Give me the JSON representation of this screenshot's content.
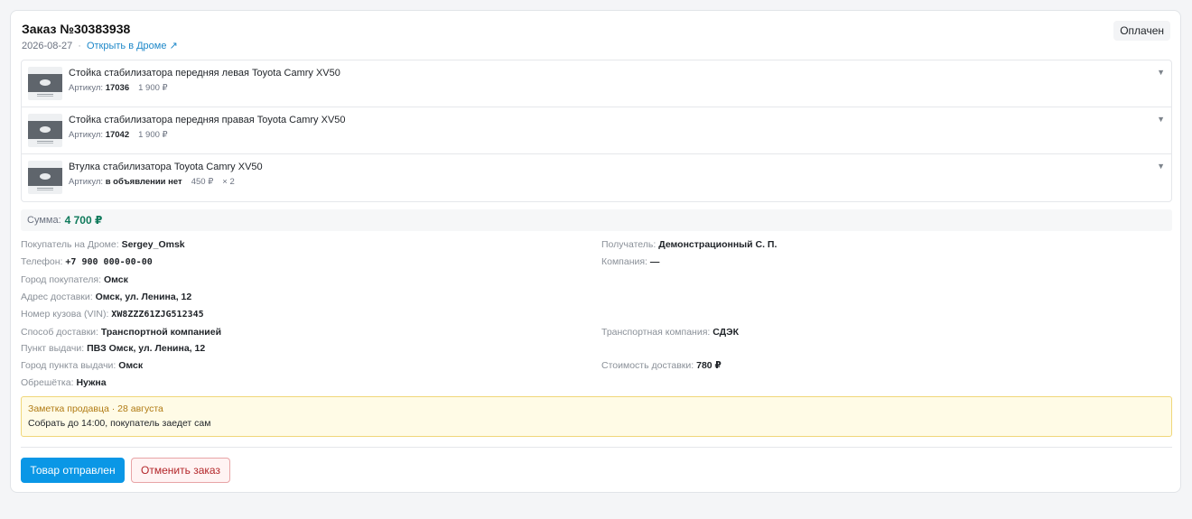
{
  "order": {
    "title": "Заказ №30383938",
    "date": "2026-08-27",
    "separator": "·",
    "open_link": "Открыть в Дроме ↗",
    "status": "Оплачен"
  },
  "items": [
    {
      "name": "Стойка стабилизатора передняя левая Toyota Camry XV50",
      "sku_label": "Артикул:",
      "sku": "17036",
      "price": "1 900 ₽",
      "qty": ""
    },
    {
      "name": "Стойка стабилизатора передняя правая Toyota Camry XV50",
      "sku_label": "Артикул:",
      "sku": "17042",
      "price": "1 900 ₽",
      "qty": ""
    },
    {
      "name": "Втулка стабилизатора Toyota Camry XV50",
      "sku_label": "Артикул:",
      "sku": "в объявлении нет",
      "price": "450 ₽",
      "qty": "× 2"
    }
  ],
  "chevron": "▼",
  "sum": {
    "label": "Сумма:",
    "value": "4 700 ₽"
  },
  "fields": {
    "buyer": {
      "label": "Покупатель на Дроме:",
      "value": "Sergey_Omsk"
    },
    "phone": {
      "label": "Телефон:",
      "value": "+7 900 000-00-00"
    },
    "city": {
      "label": "Город покупателя:",
      "value": "Омск"
    },
    "address": {
      "label": "Адрес доставки:",
      "value": "Омск, ул. Ленина, 12"
    },
    "vin": {
      "label": "Номер кузова (VIN):",
      "value": "XW8ZZZ61ZJG512345"
    },
    "delivery_method": {
      "label": "Способ доставки:",
      "value": "Транспортной компанией"
    },
    "pickup_point": {
      "label": "Пункт выдачи:",
      "value": "ПВЗ Омск, ул. Ленина, 12"
    },
    "pickup_city": {
      "label": "Город пункта выдачи:",
      "value": "Омск"
    },
    "crate": {
      "label": "Обрешётка:",
      "value": "Нужна"
    },
    "recipient": {
      "label": "Получатель:",
      "value": "Демонстрационный С. П."
    },
    "company": {
      "label": "Компания:",
      "value": "—"
    },
    "transport_company": {
      "label": "Транспортная компания:",
      "value": "СДЭК"
    },
    "delivery_cost": {
      "label": "Стоимость доставки:",
      "value": "780 ₽"
    }
  },
  "note": {
    "header": "Заметка продавца · 28 августа",
    "text": "Собрать до 14:00, покупатель заедет сам"
  },
  "actions": {
    "shipped": "Товар отправлен",
    "cancel": "Отменить заказ"
  },
  "colors": {
    "primary": "#0a97e6",
    "sum": "#0f7a5b",
    "danger": "#b3262a",
    "note_bg": "#fffbe6"
  }
}
